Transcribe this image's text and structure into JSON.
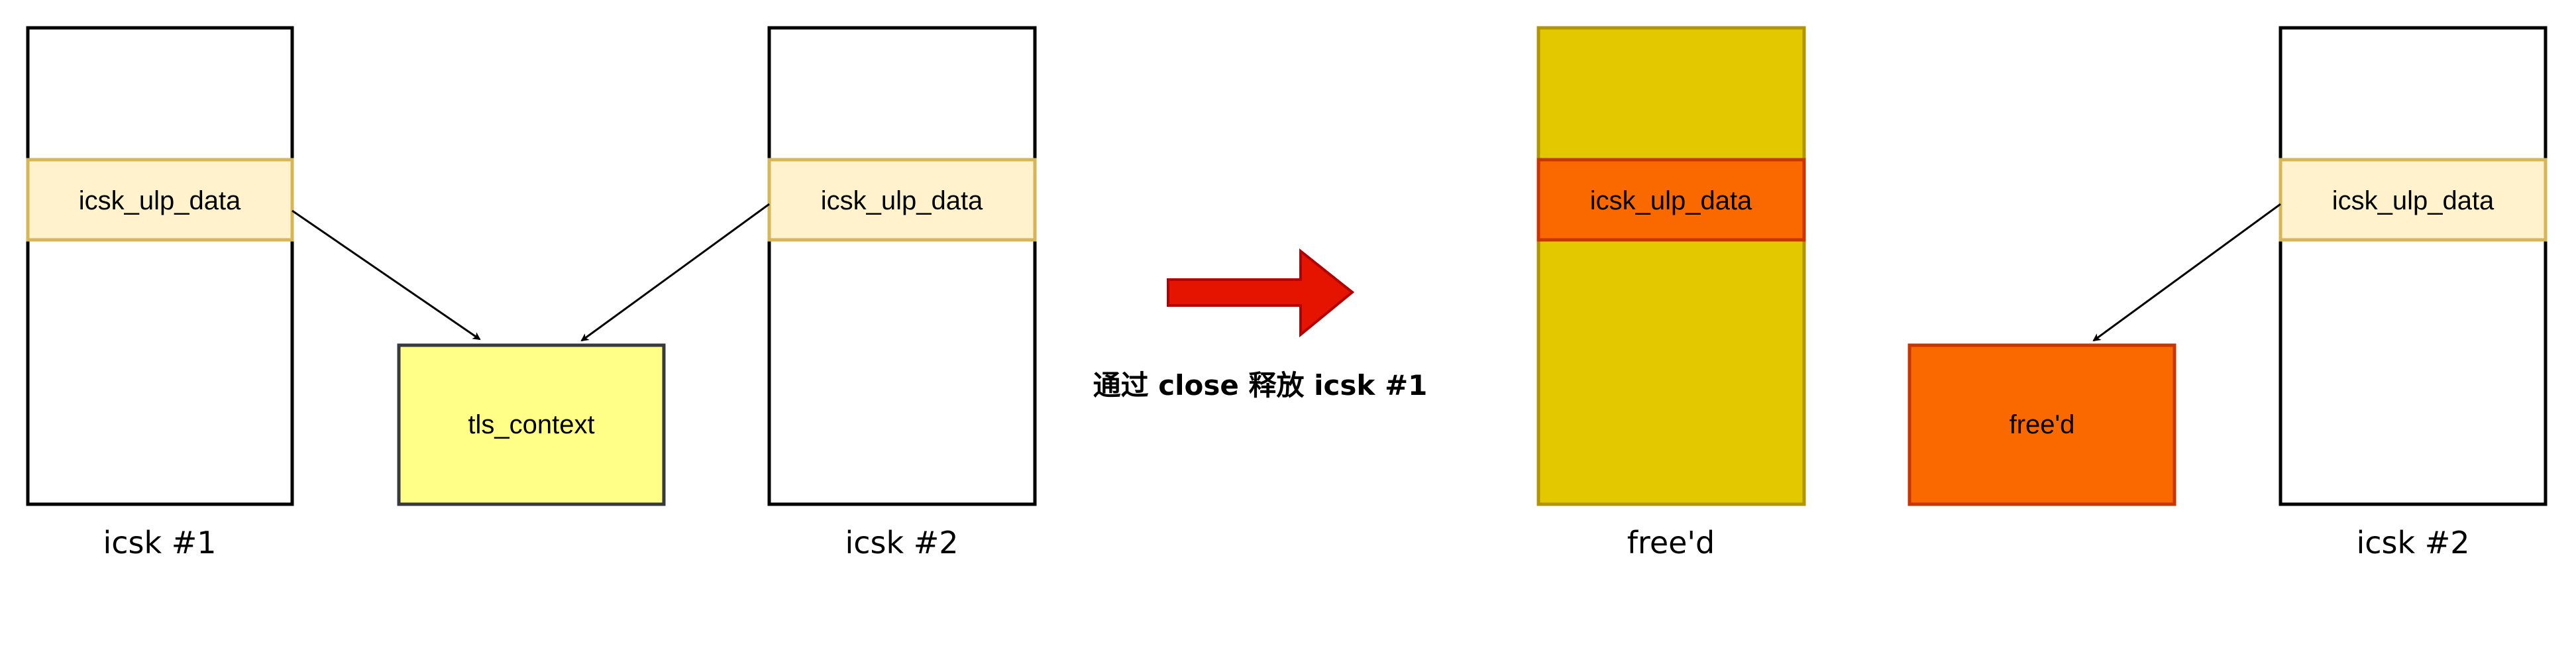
{
  "before": {
    "socket1": {
      "field": "icsk_ulp_data",
      "caption": "icsk #1"
    },
    "context": {
      "label": "tls_context"
    },
    "socket2": {
      "field": "icsk_ulp_data",
      "caption": "icsk #2"
    }
  },
  "transition": {
    "label": "通过 close 释放 icsk #1"
  },
  "after": {
    "socket1": {
      "field": "icsk_ulp_data",
      "caption": "free'd"
    },
    "context": {
      "label": "free'd"
    },
    "socket2": {
      "field": "icsk_ulp_data",
      "caption": "icsk #2"
    }
  },
  "colors": {
    "field_fill": "#fff2cc",
    "field_stroke": "#d6b656",
    "context_fill": "#ffff88",
    "freed_fill": "#e3c800",
    "freed_orange": "#fa6800",
    "arrow_red": "#e51400"
  }
}
